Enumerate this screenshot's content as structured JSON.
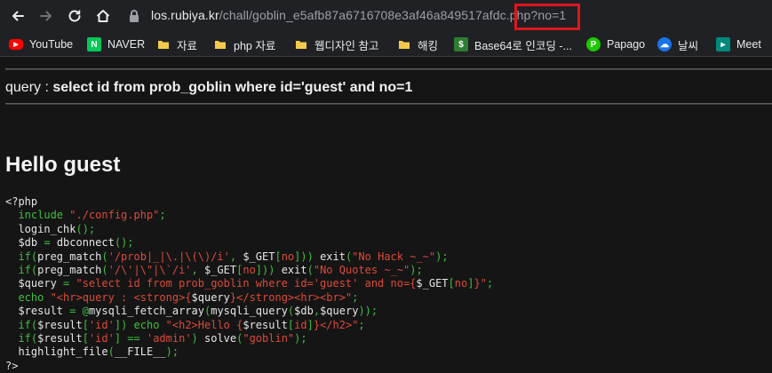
{
  "browser": {
    "url_host": "los.rubiya.kr",
    "url_path": "/chall/goblin_e5afb87a6716708e3af46a849517afdc.php?no=1",
    "highlight_color": "#e0161d"
  },
  "bookmarks": [
    {
      "label": "YouTube",
      "icon": "youtube-icon",
      "color": "#ff0000"
    },
    {
      "label": "NAVER",
      "icon": "naver-icon",
      "color": "#03c75a"
    },
    {
      "label": "자료",
      "icon": "folder-icon",
      "color": "#f2c94c"
    },
    {
      "label": "php 자료",
      "icon": "folder-icon",
      "color": "#f2c94c"
    },
    {
      "label": "웹디자인 참고",
      "icon": "folder-icon",
      "color": "#f2c94c"
    },
    {
      "label": "해킹",
      "icon": "folder-icon",
      "color": "#f2c94c"
    },
    {
      "label": "Base64로 인코딩 -...",
      "icon": "base64-icon",
      "color": "#2e7d32"
    },
    {
      "label": "Papago",
      "icon": "papago-icon",
      "color": "#1ec800"
    },
    {
      "label": "날씨",
      "icon": "weather-icon",
      "color": "#1a73e8"
    },
    {
      "label": "Meet",
      "icon": "meet-icon",
      "color": "#00897b"
    }
  ],
  "page": {
    "query_label": "query : ",
    "query_sql": "select id from prob_goblin where id='guest' and no=1",
    "hello": "Hello guest"
  },
  "source_code": [
    {
      "parts": [
        {
          "t": "<?php",
          "c": "d"
        }
      ]
    },
    {
      "parts": [
        {
          "t": "  include ",
          "c": "k"
        },
        {
          "t": "\"./config.php\"",
          "c": "s"
        },
        {
          "t": ";",
          "c": "k"
        }
      ]
    },
    {
      "parts": [
        {
          "t": "  login_chk",
          "c": "d"
        },
        {
          "t": "();",
          "c": "k"
        }
      ]
    },
    {
      "parts": [
        {
          "t": "  $db ",
          "c": "d"
        },
        {
          "t": "= ",
          "c": "k"
        },
        {
          "t": "dbconnect",
          "c": "d"
        },
        {
          "t": "();",
          "c": "k"
        }
      ]
    },
    {
      "parts": [
        {
          "t": "  if(",
          "c": "k"
        },
        {
          "t": "preg_match",
          "c": "d"
        },
        {
          "t": "(",
          "c": "k"
        },
        {
          "t": "'/prob|_|\\.|\\(\\)/i'",
          "c": "s"
        },
        {
          "t": ", ",
          "c": "k"
        },
        {
          "t": "$_GET",
          "c": "d"
        },
        {
          "t": "[",
          "c": "k"
        },
        {
          "t": "no",
          "c": "s"
        },
        {
          "t": "])) ",
          "c": "k"
        },
        {
          "t": "exit",
          "c": "d"
        },
        {
          "t": "(",
          "c": "k"
        },
        {
          "t": "\"No Hack ~_~\"",
          "c": "s"
        },
        {
          "t": ");",
          "c": "k"
        }
      ]
    },
    {
      "parts": [
        {
          "t": "  if(",
          "c": "k"
        },
        {
          "t": "preg_match",
          "c": "d"
        },
        {
          "t": "(",
          "c": "k"
        },
        {
          "t": "'/\\'|\\\"|\\`/i'",
          "c": "s"
        },
        {
          "t": ", ",
          "c": "k"
        },
        {
          "t": "$_GET",
          "c": "d"
        },
        {
          "t": "[",
          "c": "k"
        },
        {
          "t": "no",
          "c": "s"
        },
        {
          "t": "])) ",
          "c": "k"
        },
        {
          "t": "exit",
          "c": "d"
        },
        {
          "t": "(",
          "c": "k"
        },
        {
          "t": "\"No Quotes ~_~\"",
          "c": "s"
        },
        {
          "t": ");",
          "c": "k"
        }
      ]
    },
    {
      "parts": [
        {
          "t": "  $query ",
          "c": "d"
        },
        {
          "t": "= ",
          "c": "k"
        },
        {
          "t": "\"select id from prob_goblin where id='guest' and no={",
          "c": "s"
        },
        {
          "t": "$_GET",
          "c": "d"
        },
        {
          "t": "[",
          "c": "k"
        },
        {
          "t": "no",
          "c": "s"
        },
        {
          "t": "]",
          "c": "k"
        },
        {
          "t": "}\"",
          "c": "s"
        },
        {
          "t": ";",
          "c": "k"
        }
      ]
    },
    {
      "parts": [
        {
          "t": "  echo ",
          "c": "k"
        },
        {
          "t": "\"<hr>query : <strong>{",
          "c": "s"
        },
        {
          "t": "$query",
          "c": "d"
        },
        {
          "t": "}</strong><hr><br>\"",
          "c": "s"
        },
        {
          "t": ";",
          "c": "k"
        }
      ]
    },
    {
      "parts": [
        {
          "t": "  $result ",
          "c": "d"
        },
        {
          "t": "= @",
          "c": "k"
        },
        {
          "t": "mysqli_fetch_array",
          "c": "d"
        },
        {
          "t": "(",
          "c": "k"
        },
        {
          "t": "mysqli_query",
          "c": "d"
        },
        {
          "t": "(",
          "c": "k"
        },
        {
          "t": "$db",
          "c": "d"
        },
        {
          "t": ",",
          "c": "k"
        },
        {
          "t": "$query",
          "c": "d"
        },
        {
          "t": "));",
          "c": "k"
        }
      ]
    },
    {
      "parts": [
        {
          "t": "  if(",
          "c": "k"
        },
        {
          "t": "$result",
          "c": "d"
        },
        {
          "t": "[",
          "c": "k"
        },
        {
          "t": "'id'",
          "c": "s"
        },
        {
          "t": "]) echo ",
          "c": "k"
        },
        {
          "t": "\"<h2>Hello {",
          "c": "s"
        },
        {
          "t": "$result",
          "c": "d"
        },
        {
          "t": "[",
          "c": "k"
        },
        {
          "t": "id",
          "c": "s"
        },
        {
          "t": "]",
          "c": "k"
        },
        {
          "t": "}</h2>\"",
          "c": "s"
        },
        {
          "t": ";",
          "c": "k"
        }
      ]
    },
    {
      "parts": [
        {
          "t": "  if(",
          "c": "k"
        },
        {
          "t": "$result",
          "c": "d"
        },
        {
          "t": "[",
          "c": "k"
        },
        {
          "t": "'id'",
          "c": "s"
        },
        {
          "t": "] == ",
          "c": "k"
        },
        {
          "t": "'admin'",
          "c": "s"
        },
        {
          "t": ") ",
          "c": "k"
        },
        {
          "t": "solve",
          "c": "d"
        },
        {
          "t": "(",
          "c": "k"
        },
        {
          "t": "\"goblin\"",
          "c": "s"
        },
        {
          "t": ");",
          "c": "k"
        }
      ]
    },
    {
      "parts": [
        {
          "t": "  highlight_file",
          "c": "d"
        },
        {
          "t": "(",
          "c": "k"
        },
        {
          "t": "__FILE__",
          "c": "d"
        },
        {
          "t": ");",
          "c": "k"
        }
      ]
    },
    {
      "parts": [
        {
          "t": "?>",
          "c": "d"
        }
      ]
    }
  ]
}
